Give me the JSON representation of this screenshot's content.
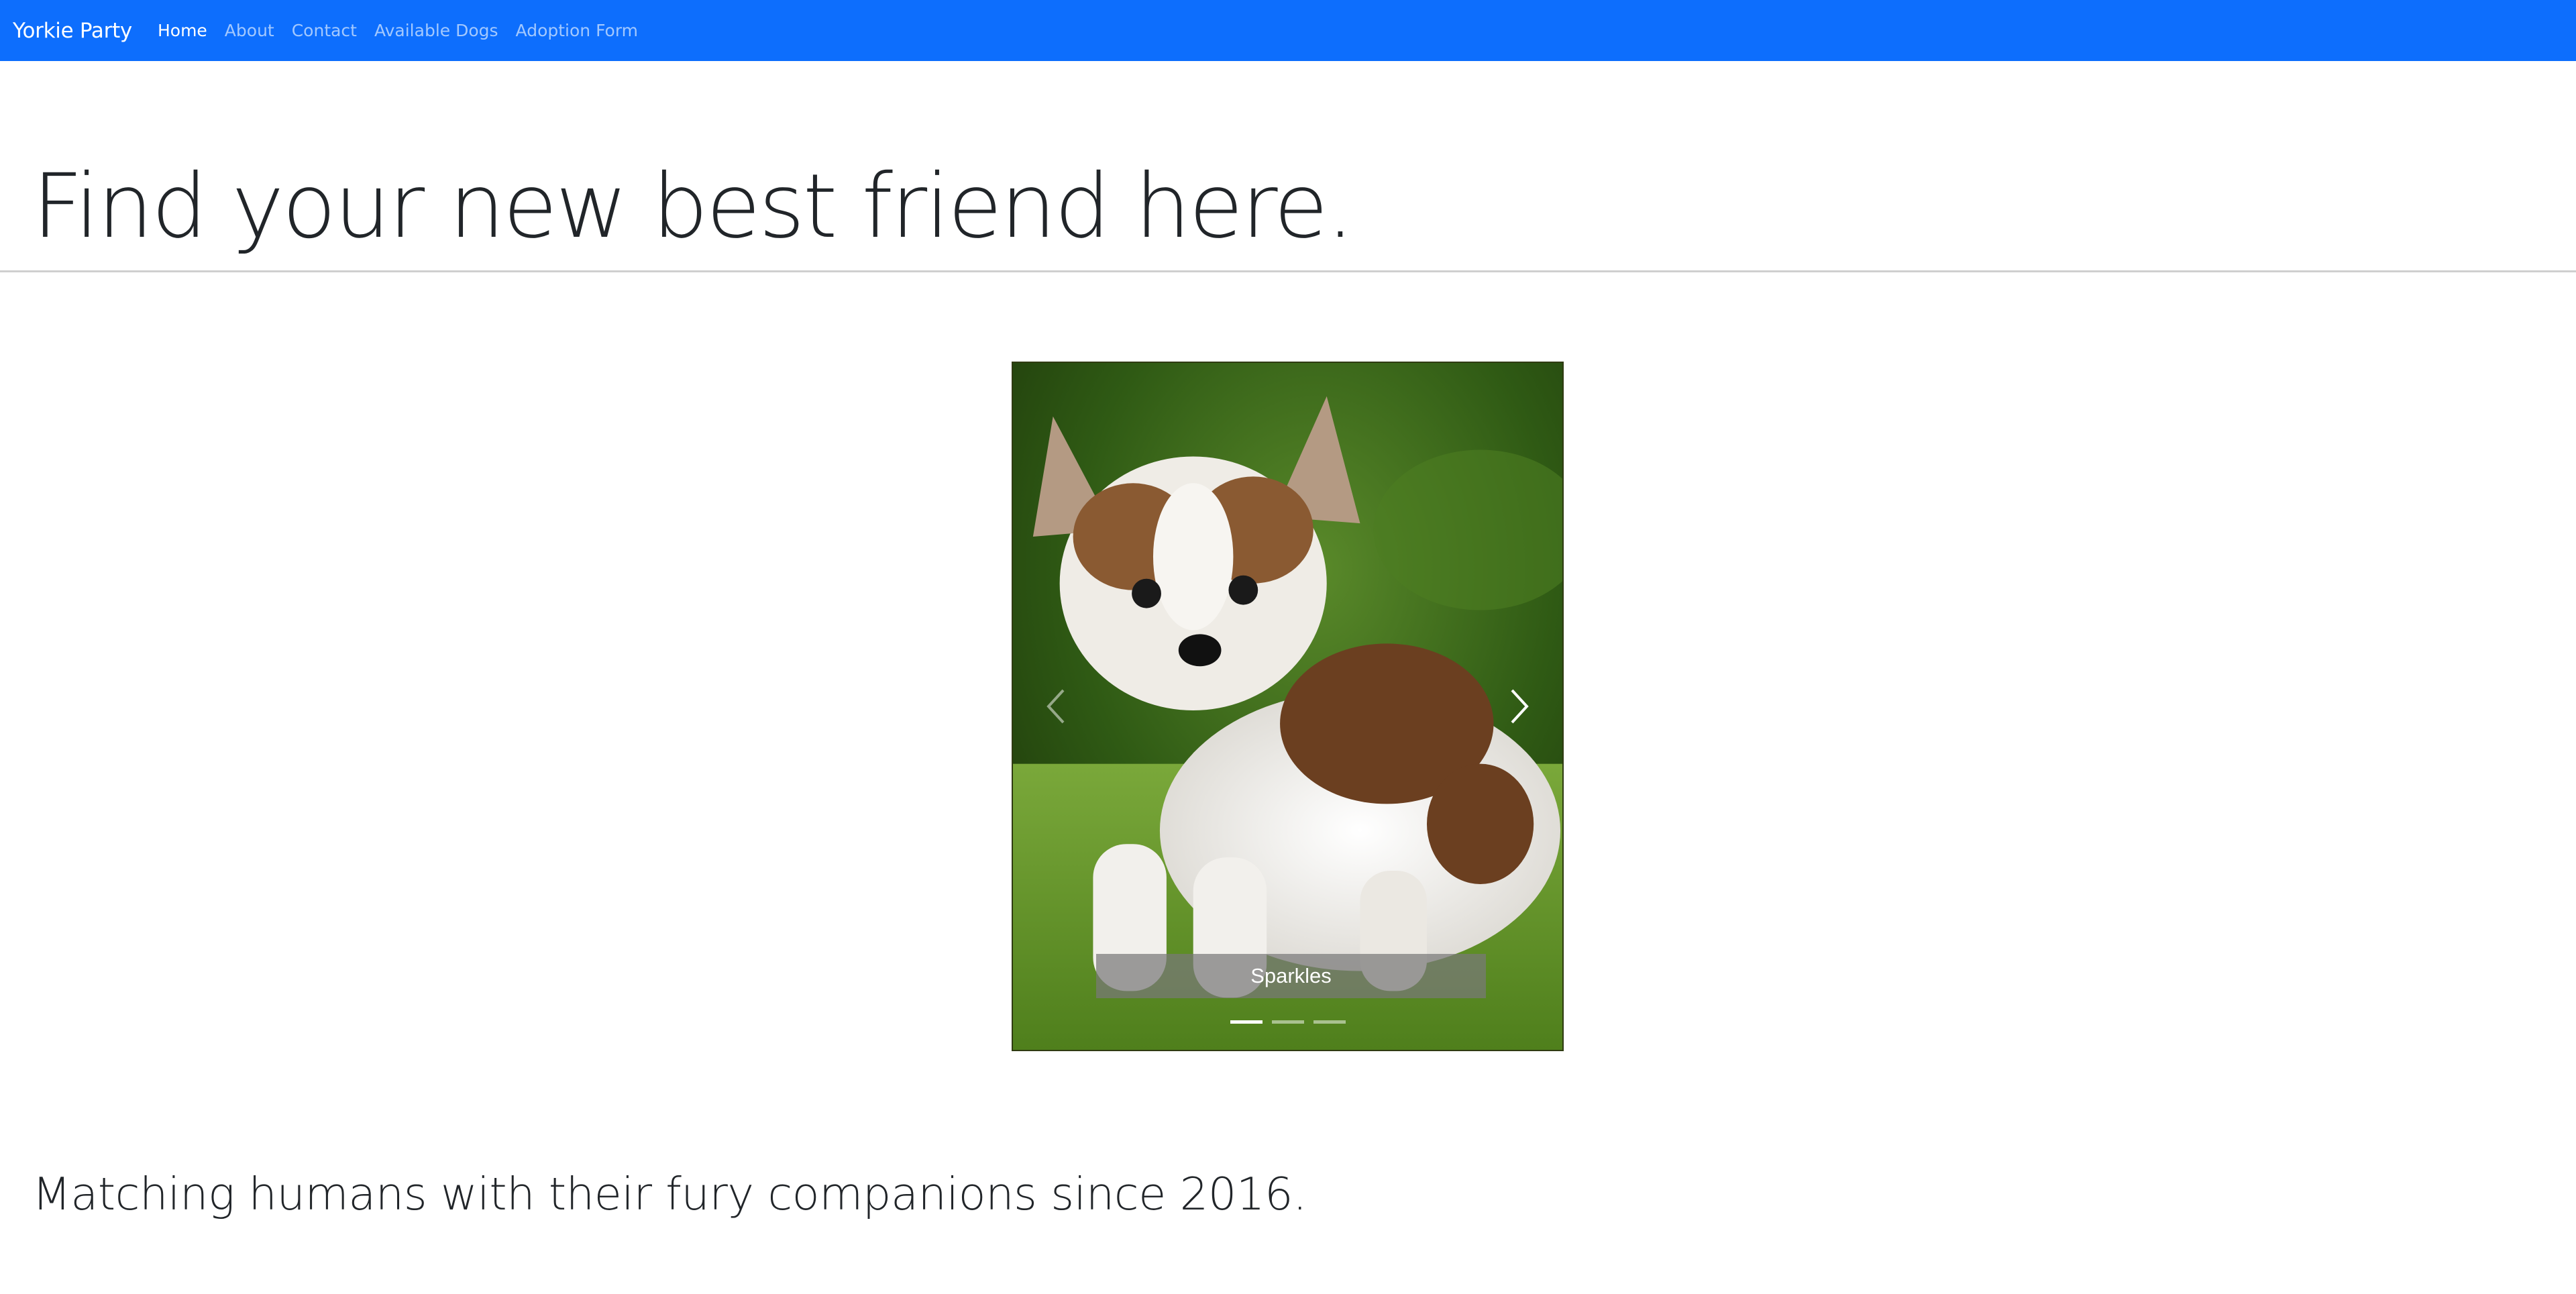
{
  "navbar": {
    "brand": "Yorkie Party",
    "links": [
      {
        "label": "Home",
        "active": true
      },
      {
        "label": "About",
        "active": false
      },
      {
        "label": "Contact",
        "active": false
      },
      {
        "label": "Available Dogs",
        "active": false
      },
      {
        "label": "Adoption Form",
        "active": false
      }
    ],
    "background_color": "#0d6efd"
  },
  "hero": {
    "headline": "Find your new best friend here."
  },
  "carousel": {
    "slides": [
      {
        "caption": "Sparkles",
        "image": "yorkie-puppy-on-grass"
      }
    ],
    "active_index": 0,
    "indicator_count": 3,
    "controls": {
      "prev_icon": "chevron-left-icon",
      "next_icon": "chevron-right-icon"
    }
  },
  "tagline": "Matching humans with their fury companions since 2016."
}
